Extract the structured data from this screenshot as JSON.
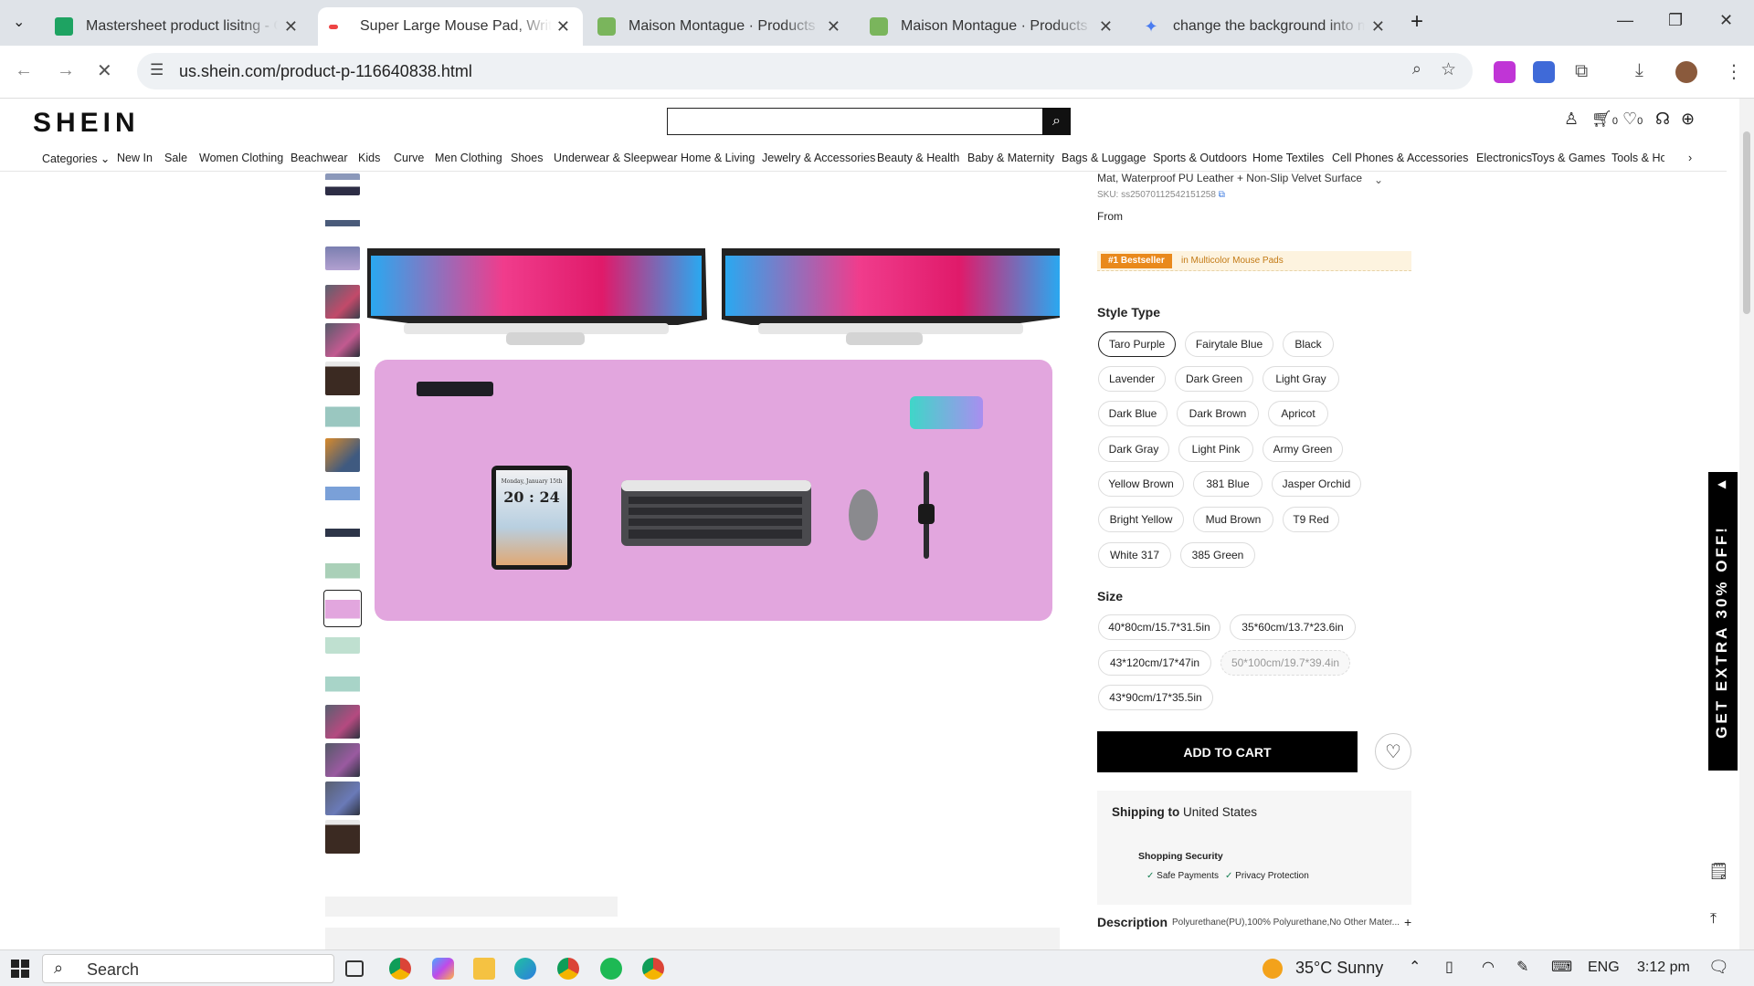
{
  "browser": {
    "tabs": [
      {
        "title": "Mastersheet product lisitng - G",
        "icon": "sheets-icon",
        "active": false
      },
      {
        "title": "Super Large Mouse Pad, Writing",
        "icon": "shein-icon",
        "active": true
      },
      {
        "title": "Maison Montague · Products · M",
        "icon": "shopify-icon",
        "active": false
      },
      {
        "title": "Maison Montague · Products · A",
        "icon": "shopify-icon",
        "active": false
      },
      {
        "title": "change the background into m",
        "icon": "gemini-icon",
        "active": false
      }
    ],
    "url": "us.shein.com/product-p-116640838.html"
  },
  "site": {
    "logo": "SHEIN",
    "search_placeholder": "",
    "cart_count": "0",
    "wishlist_count": "0",
    "nav": [
      "Categories",
      "New In",
      "Sale",
      "Women Clothing",
      "Beachwear",
      "Kids",
      "Curve",
      "Men Clothing",
      "Shoes",
      "Underwear & Sleepwear",
      "Home & Living",
      "Jewelry & Accessories",
      "Beauty & Health",
      "Baby & Maternity",
      "Bags & Luggage",
      "Sports & Outdoors",
      "Home Textiles",
      "Cell Phones & Accessories",
      "Electronics",
      "Toys & Games",
      "Tools & Hon"
    ]
  },
  "product": {
    "title_tail": "Mat, Waterproof PU Leather + Non-Slip Velvet Surface...",
    "sku": "SKU: ss25070112542151258",
    "price_prefix": "From",
    "bestseller_badge": "#1 Bestseller",
    "bestseller_category": "in Multicolor Mouse Pads",
    "style_label": "Style Type",
    "styles": [
      "Taro Purple",
      "Fairytale Blue",
      "Black",
      "Lavender",
      "Dark Green",
      "Light Gray",
      "Dark Blue",
      "Dark Brown",
      "Apricot",
      "Dark Gray",
      "Light Pink",
      "Army Green",
      "Yellow Brown",
      "381 Blue",
      "Jasper Orchid",
      "Bright Yellow",
      "Mud Brown",
      "T9 Red",
      "White 317",
      "385 Green"
    ],
    "selected_style": "Taro Purple",
    "size_label": "Size",
    "sizes": [
      "40*80cm/15.7*31.5in",
      "35*60cm/13.7*23.6in",
      "43*120cm/17*47in",
      "50*100cm/19.7*39.4in",
      "43*90cm/17*35.5in"
    ],
    "unavailable_size": "50*100cm/19.7*39.4in",
    "add_to_cart": "ADD TO CART",
    "shipping_label": "Shipping to",
    "shipping_country": "United States",
    "security_title": "Shopping Security",
    "security_items": [
      "Safe Payments",
      "Privacy Protection"
    ],
    "description_label": "Description",
    "description_text": "Polyurethane(PU),100% Polyurethane,No Other Mater..."
  },
  "image": {
    "tablet_date": "Monday, January 15th",
    "tablet_time": "20 : 24"
  },
  "promo": {
    "text": "GET EXTRA 30% OFF!"
  },
  "taskbar": {
    "search": "Search",
    "weather": "35°C Sunny",
    "lang": "ENG",
    "time": "3:12 pm"
  },
  "colors": {
    "accent": "#000000",
    "pad": "#e2a6de",
    "badge": "#e9891c"
  }
}
